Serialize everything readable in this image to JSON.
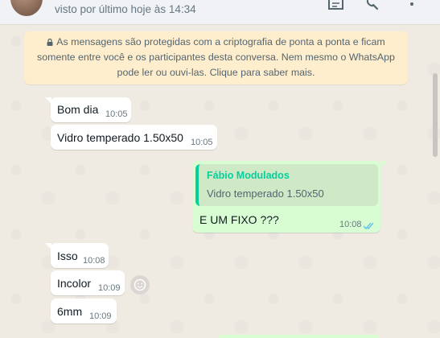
{
  "header": {
    "last_seen": "visto por último hoje às 14:34",
    "icons": [
      "search-message-icon",
      "search-icon",
      "menu-icon"
    ]
  },
  "notice": {
    "text": "As mensagens são protegidas com a criptografia de ponta a ponta e ficam somente entre você e os participantes desta conversa. Nem mesmo o WhatsApp pode ler ou ouvi-las. Clique para saber mais.",
    "line1": "As mensagens são protegidas com a criptografia de ponta a ponta e ficam",
    "line2": "somente entre você e os participantes desta conversa. Nem mesmo o WhatsApp",
    "line3": "pode ler ou ouvi-las. Clique para saber mais."
  },
  "messages": [
    {
      "direction": "in",
      "text": "Bom dia",
      "time": "10:05"
    },
    {
      "direction": "in",
      "text": "Vidro temperado 1.50x50",
      "time": "10:05"
    },
    {
      "direction": "out",
      "quote_author": "Fábio Modulados",
      "quote_text": "Vidro temperado 1.50x50",
      "text": "E UM FIXO ???",
      "time": "10:08",
      "status": "read"
    },
    {
      "direction": "in",
      "text": "Isso",
      "time": "10:08"
    },
    {
      "direction": "in",
      "text": "Incolor",
      "time": "10:09"
    },
    {
      "direction": "in",
      "text": "6mm",
      "time": "10:09"
    }
  ],
  "colors": {
    "chat_bg": "#efeae2",
    "incoming": "#ffffff",
    "outgoing": "#d9fdd3",
    "notice_bg": "#ffeecd",
    "quote_accent": "#06cf9c",
    "read_tick": "#53bdeb"
  }
}
